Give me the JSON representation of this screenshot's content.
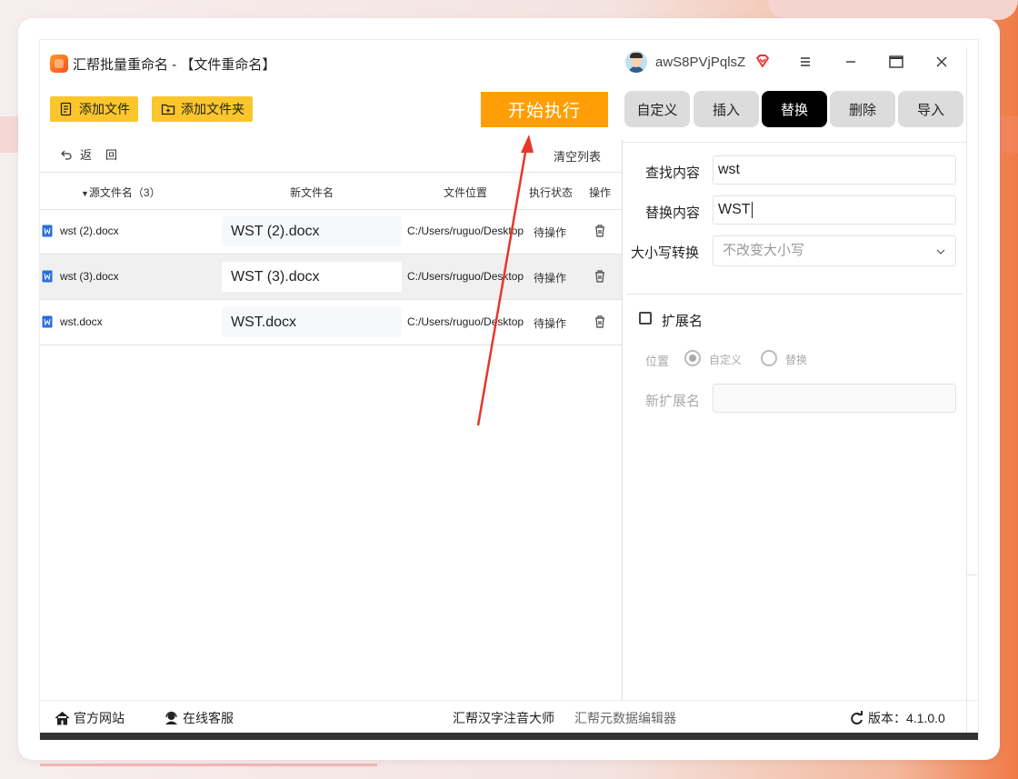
{
  "window": {
    "title": "汇帮批量重命名 - 【文件重命名】",
    "username": "awS8PVjPqlsZ"
  },
  "toolbar": {
    "add_file": "添加文件",
    "add_folder": "添加文件夹",
    "start": "开始执行"
  },
  "tabs": [
    {
      "label": "自定义",
      "active": false
    },
    {
      "label": "插入",
      "active": false
    },
    {
      "label": "替换",
      "active": true
    },
    {
      "label": "删除",
      "active": false
    },
    {
      "label": "导入",
      "active": false
    }
  ],
  "list": {
    "back": "返回",
    "clear": "清空列表",
    "columns": {
      "source": "源文件名（3）",
      "new_name": "新文件名",
      "location": "文件位置",
      "status": "执行状态",
      "action": "操作"
    },
    "rows": [
      {
        "source": "wst (2).docx",
        "new_name": "WST (2).docx",
        "path": "C:/Users/ruguo/Desktop",
        "status": "待操作"
      },
      {
        "source": "wst (3).docx",
        "new_name": "WST (3).docx",
        "path": "C:/Users/ruguo/Desktop",
        "status": "待操作"
      },
      {
        "source": "wst.docx",
        "new_name": "WST.docx",
        "path": "C:/Users/ruguo/Desktop",
        "status": "待操作"
      }
    ]
  },
  "panel": {
    "find_label": "查找内容",
    "find_value": "wst",
    "replace_label": "替换内容",
    "replace_value": "WST",
    "case_label": "大小写转换",
    "case_value": "不改变大小写",
    "extension_label": "扩展名",
    "extension_checked": false,
    "position_label": "位置",
    "position_options": [
      "自定义",
      "替换"
    ],
    "new_ext_label": "新扩展名",
    "new_ext_value": ""
  },
  "footer": {
    "website": "官方网站",
    "support": "在线客服",
    "link1": "汇帮汉字注音大师",
    "link2": "汇帮元数据编辑器",
    "version": "版本：4.1.0.0"
  },
  "colors": {
    "accent_orange": "#ff9f05",
    "button_yellow": "#fbc62c",
    "active_tab": "#000000",
    "arrow_red": "#e8362b"
  }
}
